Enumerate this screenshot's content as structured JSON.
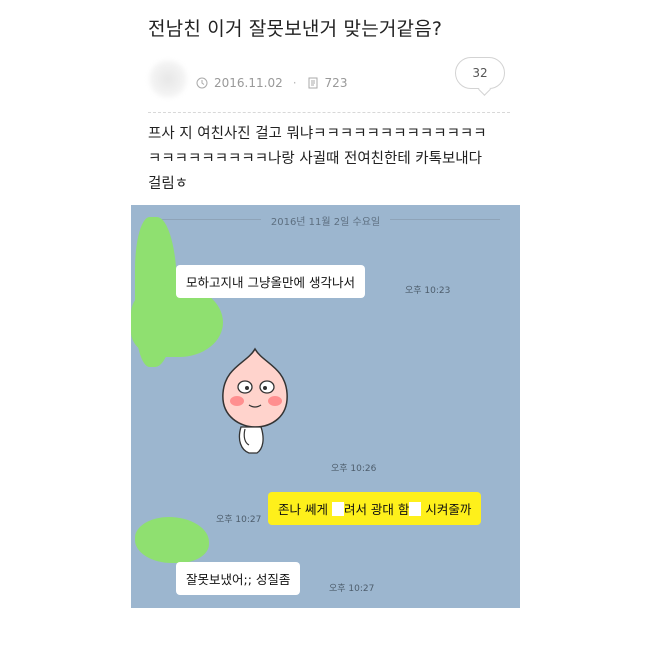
{
  "post": {
    "title": "전남친 이거 잘못보낸거 맞는거같음?",
    "date": "2016.11.02",
    "views": "723",
    "comment_count": "32",
    "body": "프사 지 여친사진 걸고 뭐냐ㅋㅋㅋㅋㅋㅋㅋㅋㅋㅋㅋㅋㅋ\nㅋㅋㅋㅋㅋㅋㅋㅋㅋ나랑 사귈때 전여친한테 카톡보내다\n걸림ㅎ"
  },
  "chat": {
    "date_divider": "2016년 11월 2일 수요일",
    "messages": [
      {
        "text": "모하고지내 그냥올만에  생각나서",
        "time": "오후 10:23"
      },
      {
        "time": "오후 10:26"
      },
      {
        "text_a": "존나 쎄게 ",
        "text_b": "려서 광대 함",
        "text_c": " 시켜줄까",
        "time": "오후 10:27"
      },
      {
        "text": "잘못보냈어;; 성질좀",
        "time": "오후 10:27"
      }
    ]
  },
  "icons": [
    "clock-icon",
    "document-icon",
    "comment-bubble-icon",
    "peach-emoticon"
  ],
  "colors": {
    "chat_bg": "#9cb6cf",
    "my_bubble": "#fef01b",
    "censor_green": "#8fe070"
  }
}
